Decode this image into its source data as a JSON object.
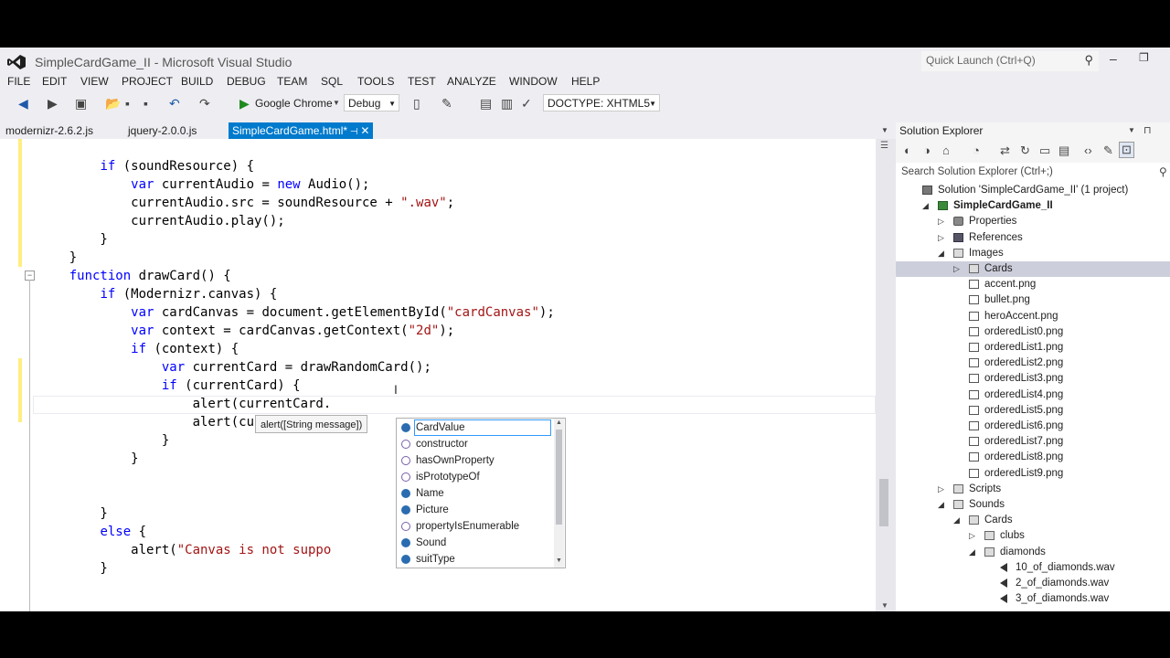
{
  "window": {
    "title": "SimpleCardGame_II - Microsoft Visual Studio",
    "quick_launch_placeholder": "Quick Launch (Ctrl+Q)"
  },
  "menu": [
    "FILE",
    "EDIT",
    "VIEW",
    "PROJECT",
    "BUILD",
    "DEBUG",
    "TEAM",
    "SQL",
    "TOOLS",
    "TEST",
    "ANALYZE",
    "WINDOW",
    "HELP"
  ],
  "toolbar": {
    "run_label": "Google Chrome",
    "config": "Debug",
    "doctype": "DOCTYPE: XHTML5"
  },
  "tabs": [
    {
      "label": "modernizr-2.6.2.js"
    },
    {
      "label": "jquery-2.0.0.js"
    },
    {
      "label": "SimpleCardGame.html*",
      "active": true
    }
  ],
  "code_lines": [
    {
      "segs": [
        {
          "t": "        "
        },
        {
          "t": "if",
          "c": "kw"
        },
        {
          "t": " (soundResource) {"
        }
      ]
    },
    {
      "segs": [
        {
          "t": "            "
        },
        {
          "t": "var",
          "c": "kw"
        },
        {
          "t": " currentAudio = "
        },
        {
          "t": "new",
          "c": "kw"
        },
        {
          "t": " Audio();"
        }
      ]
    },
    {
      "segs": [
        {
          "t": "            currentAudio.src = soundResource + "
        },
        {
          "t": "\".wav\"",
          "c": "str"
        },
        {
          "t": ";"
        }
      ]
    },
    {
      "segs": [
        {
          "t": "            currentAudio.play();"
        }
      ]
    },
    {
      "segs": [
        {
          "t": "        }"
        }
      ]
    },
    {
      "segs": [
        {
          "t": "    }"
        }
      ]
    },
    {
      "segs": [
        {
          "t": "    "
        },
        {
          "t": "function",
          "c": "kw"
        },
        {
          "t": " drawCard() {"
        }
      ]
    },
    {
      "segs": [
        {
          "t": "        "
        },
        {
          "t": "if",
          "c": "kw"
        },
        {
          "t": " (Modernizr.canvas) {"
        }
      ]
    },
    {
      "segs": [
        {
          "t": "            "
        },
        {
          "t": "var",
          "c": "kw"
        },
        {
          "t": " cardCanvas = document.getElementById("
        },
        {
          "t": "\"cardCanvas\"",
          "c": "str"
        },
        {
          "t": ");"
        }
      ]
    },
    {
      "segs": [
        {
          "t": "            "
        },
        {
          "t": "var",
          "c": "kw"
        },
        {
          "t": " context = cardCanvas.getContext("
        },
        {
          "t": "\"2d\"",
          "c": "str"
        },
        {
          "t": ");"
        }
      ]
    },
    {
      "segs": [
        {
          "t": "            "
        },
        {
          "t": "if",
          "c": "kw"
        },
        {
          "t": " (context) {"
        }
      ]
    },
    {
      "segs": [
        {
          "t": "                "
        },
        {
          "t": "var",
          "c": "kw"
        },
        {
          "t": " currentCard = drawRandomCard();"
        }
      ]
    },
    {
      "segs": [
        {
          "t": "                "
        },
        {
          "t": "if",
          "c": "kw"
        },
        {
          "t": " (currentCard) {"
        }
      ]
    },
    {
      "segs": [
        {
          "t": "                    alert(currentCard."
        }
      ]
    },
    {
      "segs": [
        {
          "t": "                    alert(currentCard("
        }
      ]
    },
    {
      "segs": [
        {
          "t": "                }"
        }
      ]
    },
    {
      "segs": [
        {
          "t": "            }"
        }
      ]
    },
    {
      "segs": [
        {
          "t": ""
        }
      ]
    },
    {
      "segs": [
        {
          "t": ""
        }
      ]
    },
    {
      "segs": [
        {
          "t": "        }"
        }
      ]
    },
    {
      "segs": [
        {
          "t": "        "
        },
        {
          "t": "else",
          "c": "kw"
        },
        {
          "t": " {"
        }
      ]
    },
    {
      "segs": [
        {
          "t": "            alert("
        },
        {
          "t": "\"Canvas is not suppo",
          "c": "str"
        }
      ]
    },
    {
      "segs": [
        {
          "t": "        }"
        }
      ]
    }
  ],
  "tooltip": "alert([String message])",
  "autocomplete": {
    "items": [
      {
        "label": "CardValue",
        "kind": "prop",
        "selected": true
      },
      {
        "label": "constructor",
        "kind": "meth"
      },
      {
        "label": "hasOwnProperty",
        "kind": "meth"
      },
      {
        "label": "isPrototypeOf",
        "kind": "meth"
      },
      {
        "label": "Name",
        "kind": "prop"
      },
      {
        "label": "Picture",
        "kind": "prop"
      },
      {
        "label": "propertyIsEnumerable",
        "kind": "meth"
      },
      {
        "label": "Sound",
        "kind": "prop"
      },
      {
        "label": "suitType",
        "kind": "prop"
      }
    ]
  },
  "solution_explorer": {
    "title": "Solution Explorer",
    "search_placeholder": "Search Solution Explorer (Ctrl+;)",
    "rows": [
      {
        "label": "Solution 'SimpleCardGame_II' (1 project)",
        "level": 0,
        "toggle": "",
        "icon": "sol"
      },
      {
        "label": "SimpleCardGame_II",
        "level": 1,
        "toggle": "open",
        "icon": "proj",
        "bold": true
      },
      {
        "label": "Properties",
        "level": 2,
        "toggle": "closed",
        "icon": "wrench"
      },
      {
        "label": "References",
        "level": 2,
        "toggle": "closed",
        "icon": "ref"
      },
      {
        "label": "Images",
        "level": 2,
        "toggle": "open",
        "icon": "folder"
      },
      {
        "label": "Cards",
        "level": 3,
        "toggle": "closed",
        "icon": "folder",
        "selected": true
      },
      {
        "label": "accent.png",
        "level": 3,
        "toggle": "",
        "icon": "png"
      },
      {
        "label": "bullet.png",
        "level": 3,
        "toggle": "",
        "icon": "png"
      },
      {
        "label": "heroAccent.png",
        "level": 3,
        "toggle": "",
        "icon": "png"
      },
      {
        "label": "orderedList0.png",
        "level": 3,
        "toggle": "",
        "icon": "png"
      },
      {
        "label": "orderedList1.png",
        "level": 3,
        "toggle": "",
        "icon": "png"
      },
      {
        "label": "orderedList2.png",
        "level": 3,
        "toggle": "",
        "icon": "png"
      },
      {
        "label": "orderedList3.png",
        "level": 3,
        "toggle": "",
        "icon": "png"
      },
      {
        "label": "orderedList4.png",
        "level": 3,
        "toggle": "",
        "icon": "png"
      },
      {
        "label": "orderedList5.png",
        "level": 3,
        "toggle": "",
        "icon": "png"
      },
      {
        "label": "orderedList6.png",
        "level": 3,
        "toggle": "",
        "icon": "png"
      },
      {
        "label": "orderedList7.png",
        "level": 3,
        "toggle": "",
        "icon": "png"
      },
      {
        "label": "orderedList8.png",
        "level": 3,
        "toggle": "",
        "icon": "png"
      },
      {
        "label": "orderedList9.png",
        "level": 3,
        "toggle": "",
        "icon": "png"
      },
      {
        "label": "Scripts",
        "level": 2,
        "toggle": "closed",
        "icon": "folder"
      },
      {
        "label": "Sounds",
        "level": 2,
        "toggle": "open",
        "icon": "folder"
      },
      {
        "label": "Cards",
        "level": 3,
        "toggle": "open",
        "icon": "folder"
      },
      {
        "label": "clubs",
        "level": 4,
        "toggle": "closed",
        "icon": "folder"
      },
      {
        "label": "diamonds",
        "level": 4,
        "toggle": "open",
        "icon": "folder"
      },
      {
        "label": "10_of_diamonds.wav",
        "level": 5,
        "toggle": "",
        "icon": "snd"
      },
      {
        "label": "2_of_diamonds.wav",
        "level": 5,
        "toggle": "",
        "icon": "snd"
      },
      {
        "label": "3_of_diamonds.wav",
        "level": 5,
        "toggle": "",
        "icon": "snd"
      }
    ]
  },
  "colors": {
    "accent": "#007acc",
    "keyword": "#0000ff",
    "string": "#a31515",
    "background": "#eeeef2",
    "selection": "#cccedb"
  }
}
